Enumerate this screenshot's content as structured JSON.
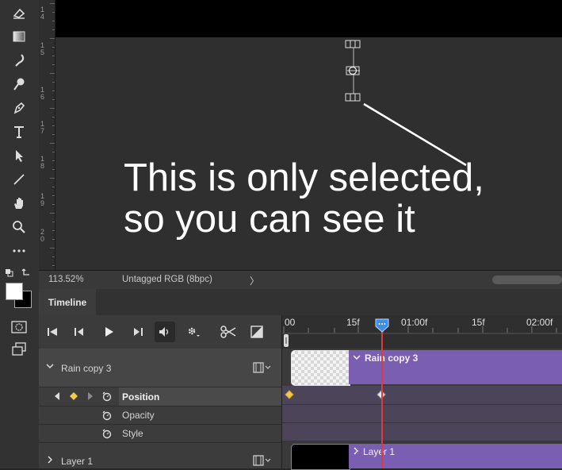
{
  "ruler": {
    "marks": [
      "1\n4",
      "1\n5",
      "1\n6",
      "1\n7",
      "1\n8",
      "1\n9",
      "2\n0"
    ]
  },
  "annotation": {
    "line1": "This is only selected,",
    "line2": "so you can see it"
  },
  "status": {
    "zoom": "113.52%",
    "profile": "Untagged RGB (8bpc)",
    "arrow": "〉"
  },
  "timeline": {
    "tab": "Timeline",
    "time_labels": [
      "00",
      "15f",
      "01:00f",
      "15f",
      "02:00f"
    ],
    "layers": [
      {
        "name": "Rain copy 3",
        "clip_label": "Rain copy 3",
        "expanded": true,
        "properties": [
          "Position",
          "Opacity",
          "Style"
        ]
      },
      {
        "name": "Layer 1",
        "clip_label": "Layer 1",
        "expanded": false
      }
    ]
  },
  "colors": {
    "clip": "#7a5eb1",
    "playhead": "#e0393e",
    "keyframe": "#f2c94c",
    "playhead_handle": "#3d8ee6"
  }
}
